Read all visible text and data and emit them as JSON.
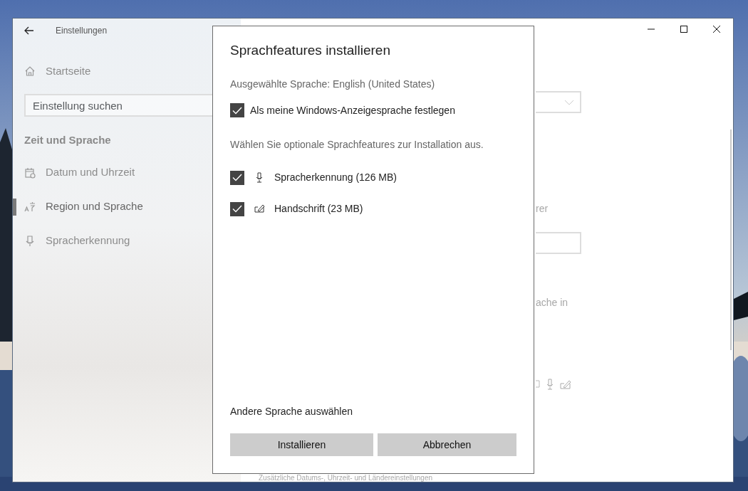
{
  "window": {
    "title": "Einstellungen"
  },
  "sidebar": {
    "home": "Startseite",
    "search": {
      "placeholder": "Einstellung suchen"
    },
    "section": "Zeit und Sprache",
    "items": [
      {
        "kind": "calendar",
        "label": "Datum und Uhrzeit",
        "selected": false
      },
      {
        "kind": "language",
        "label": "Region und Sprache",
        "selected": true
      },
      {
        "kind": "microphone",
        "label": "Spracherkennung",
        "selected": false
      }
    ]
  },
  "page": {
    "text_1": "rer",
    "text_2": "ache in",
    "footer_link": "Zusätzliche Datums-, Uhrzeit- und Ländereinstellungen"
  },
  "dialog": {
    "title": "Sprachfeatures installieren",
    "selected_language": "Ausgewählte Sprache: English (United States)",
    "display_language": {
      "label": "Als meine Windows-Anzeigesprache festlegen",
      "checked": true
    },
    "instruction": "Wählen Sie optionale Sprachfeatures zur Installation aus.",
    "features": [
      {
        "kind": "speech",
        "label": "Spracherkennung (126 MB)",
        "checked": true
      },
      {
        "kind": "handwriting",
        "label": "Handschrift (23 MB)",
        "checked": true
      }
    ],
    "link": "Andere Sprache auswählen",
    "buttons": [
      "Installieren",
      "Abbrechen"
    ]
  }
}
